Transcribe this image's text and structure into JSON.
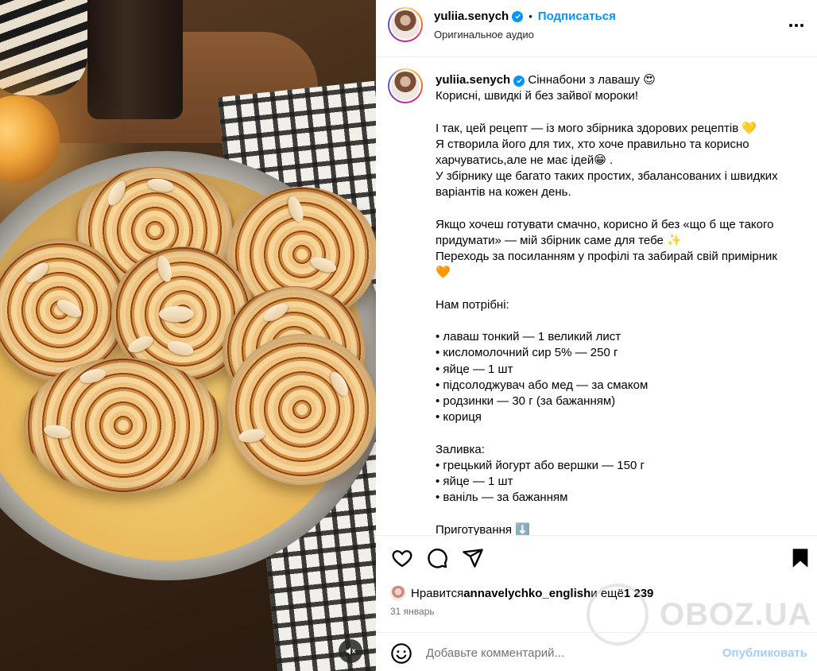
{
  "account": {
    "username": "yuliia.senych",
    "follow_label": "Подписаться",
    "dot": "•",
    "audio_label": "Оригинальное аудио"
  },
  "caption": {
    "lines": [
      "Сіннабони з лавашу 😍",
      "Корисні, швидкі й без зайвої мороки!",
      "",
      "І так, цей рецепт — із мого збірника здорових рецептів 💛",
      "Я створила його для тих, хто хоче правильно та корисно",
      "харчуватись,але не має ідей😁 .",
      "У збірнику ще багато таких простих, збалансованих і швидких",
      "варіантів на кожен день.",
      "",
      "Якщо хочеш готувати смачно, корисно й без «що б ще такого",
      "придумати» — мій збірник саме для тебе ✨",
      "Переходь за посиланням у профілі та забирай свій примірник",
      "🧡",
      "",
      "Нам потрібні:",
      "",
      "• лаваш тонкий — 1 великий лист",
      "• кисломолочний сир 5% — 250 г",
      "• яйце — 1 шт",
      "• підсолоджувач або мед — за смаком",
      "• родзинки — 30 г (за бажанням)",
      "• кориця",
      "",
      "Заливка:",
      "• грецький йогурт або вершки — 150 г",
      "• яйце — 1 шт",
      "• ваніль — за бажанням",
      "",
      "Приготування ⬇️"
    ]
  },
  "likes": {
    "prefix": "Нравится ",
    "user": "annavelychko_english",
    "middle": " и ещё ",
    "count": "1 239"
  },
  "date": "31 январь",
  "comment": {
    "placeholder": "Добавьте комментарий...",
    "post_label": "Опубликовать"
  },
  "watermark": "OBOZ.UA",
  "icons": {
    "like": "heart-icon",
    "comment": "comment-icon",
    "share": "share-icon",
    "save": "bookmark-icon",
    "more": "more-icon",
    "mute": "muted-speaker-icon",
    "emoji": "emoji-icon"
  },
  "colors": {
    "follow": "#0095f6",
    "verified": "#0095f6",
    "post_disabled": "#a5cdf5",
    "meta_text": "#737373"
  }
}
